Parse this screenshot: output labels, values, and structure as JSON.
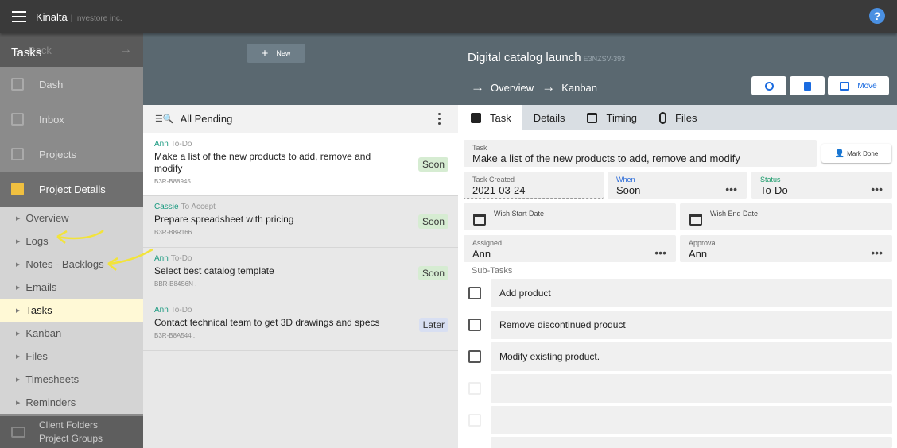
{
  "topbar": {
    "brand": "Kinalta",
    "brand_sub": "| Investore inc.",
    "help": "?"
  },
  "sidebar": {
    "back": "Back",
    "items": [
      {
        "label": "Dash"
      },
      {
        "label": "Inbox"
      },
      {
        "label": "Projects"
      },
      {
        "label": "Project Details"
      }
    ],
    "sub_items": [
      "Overview",
      "Logs",
      "Notes - Backlogs",
      "Emails",
      "Tasks",
      "Kanban",
      "Files",
      "Timesheets",
      "Reminders"
    ],
    "active_sub": "Tasks",
    "bottom": {
      "line1": "Client Folders",
      "line2": "Project Groups"
    }
  },
  "tasks": {
    "title": "Tasks",
    "new_label": "New",
    "filter": "All Pending",
    "rows": [
      {
        "who": "Ann",
        "state": "To-Do",
        "title": "Make a list of the new products to add, remove and modify",
        "code": "B3R-B88945 .",
        "badge": "Soon"
      },
      {
        "who": "Cassie",
        "state": "To Accept",
        "title": "Prepare spreadsheet with pricing",
        "code": "B3R-B8R166 .",
        "badge": "Soon"
      },
      {
        "who": "Ann",
        "state": "To-Do",
        "title": "Select best catalog template",
        "code": "BBR-B84S6N .",
        "badge": "Soon"
      },
      {
        "who": "Ann",
        "state": "To-Do",
        "title": "Contact technical team to get 3D drawings and specs",
        "code": "B3R-B8A544 .",
        "badge": "Later"
      }
    ]
  },
  "detail": {
    "title": "Digital catalog launch",
    "code": "E3NZSV-393",
    "crumb1": "Overview",
    "crumb2": "Kanban",
    "move_label": "Move",
    "tabs": [
      "Task",
      "Details",
      "Timing",
      "Files"
    ],
    "task_label": "Task",
    "task_value": "Make a list of the new products to add, remove and modify",
    "mark_done": "Mark Done",
    "created_label": "Task Created",
    "created_value": "2021-03-24",
    "when_label": "When",
    "when_value": "Soon",
    "status_label": "Status",
    "status_value": "To-Do",
    "wish_start": "Wish Start Date",
    "wish_end": "Wish End Date",
    "assigned_label": "Assigned",
    "assigned_value": "Ann",
    "approval_label": "Approval",
    "approval_value": "Ann",
    "subtasks_label": "Sub-Tasks",
    "subtasks": [
      "Add product",
      "Remove discontinued product",
      "Modify existing product."
    ]
  },
  "colors": {
    "accent_blue": "#1a6be0",
    "header_slate": "#5a6870",
    "annotation_arrow": "#f2e33b"
  }
}
